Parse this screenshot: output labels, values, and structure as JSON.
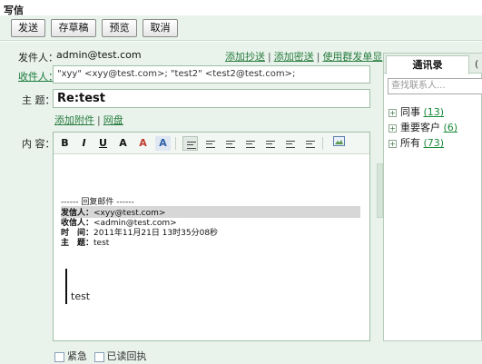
{
  "page": {
    "title": "写信"
  },
  "toolbar": {
    "send": "发送",
    "save_draft": "存草稿",
    "preview": "预览",
    "cancel": "取消"
  },
  "form": {
    "sender_label": "发件人：",
    "sender_value": "admin@test.com",
    "links": {
      "add_cc": "添加抄送",
      "add_bcc": "添加密送",
      "group_send": "使用群发单显"
    },
    "recipient_label": "收件人：",
    "recipient_value": "\"xyy\" <xyy@test.com>; \"test2\" <test2@test.com>;",
    "subject_label": "主 题：",
    "subject_value": "Re:test",
    "attach_link": "添加附件",
    "netdisk_link": "网盘",
    "content_label": "内 容："
  },
  "editor": {
    "tools": {
      "bold": "B",
      "italic": "I",
      "underline": "U",
      "font_size": "A",
      "font_color": "A",
      "bg_color": "A"
    },
    "quote_header": "------ 回复邮件 ------",
    "quote_lines": [
      {
        "key": "发信人：",
        "value": "<xyy@test.com>"
      },
      {
        "key": "收信人：",
        "value": "<admin@test.com>"
      },
      {
        "key": "时　间：",
        "value": "2011年11月21日 13时35分08秒"
      },
      {
        "key": "主　题：",
        "value": "test"
      }
    ],
    "body_text": "test"
  },
  "contacts": {
    "tab_active": "通讯录",
    "tab_other": "(",
    "search_placeholder": "查找联系人...",
    "groups": [
      {
        "name": "同事",
        "count": "(13)"
      },
      {
        "name": "重要客户",
        "count": "(6)"
      },
      {
        "name": "所有",
        "count": "(73)"
      }
    ]
  },
  "options": {
    "urgent": "紧急",
    "read_receipt": "已读回执"
  }
}
